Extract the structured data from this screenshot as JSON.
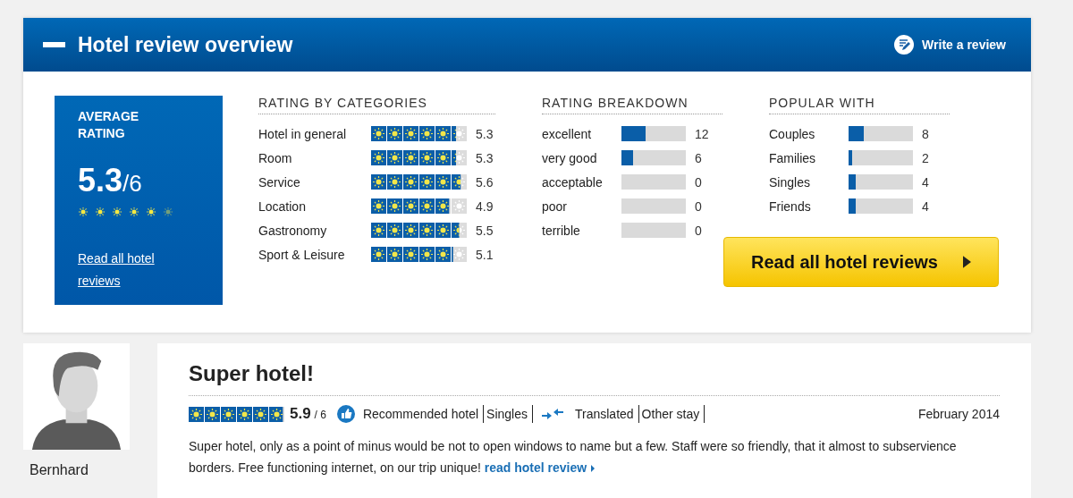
{
  "header": {
    "title": "Hotel review overview",
    "write_review": "Write a review"
  },
  "average": {
    "label": "AVERAGE RATING",
    "score": "5.3",
    "scale": "/6",
    "stars": 5.3,
    "link": "Read all hotel reviews"
  },
  "categories": {
    "title": "RATING BY CATEGORIES",
    "rows": [
      {
        "name": "Hotel in general",
        "stars": 5.3,
        "value": "5.3"
      },
      {
        "name": "Room",
        "stars": 5.3,
        "value": "5.3"
      },
      {
        "name": "Service",
        "stars": 5.6,
        "value": "5.6"
      },
      {
        "name": "Location",
        "stars": 4.9,
        "value": "4.9"
      },
      {
        "name": "Gastronomy",
        "stars": 5.5,
        "value": "5.5"
      },
      {
        "name": "Sport & Leisure",
        "stars": 5.1,
        "value": "5.1"
      }
    ]
  },
  "breakdown": {
    "title": "RATING BREAKDOWN",
    "rows": [
      {
        "name": "excellent",
        "level": 0.37,
        "count": "12"
      },
      {
        "name": "very good",
        "level": 0.18,
        "count": "6"
      },
      {
        "name": "acceptable",
        "count": "0"
      },
      {
        "name": "poor",
        "count": "0"
      },
      {
        "name": "terrible",
        "count": "0"
      }
    ]
  },
  "popular": {
    "title": "POPULAR WITH",
    "rows": [
      {
        "name": "Couples",
        "level": 0.24,
        "count": "8"
      },
      {
        "name": "Families",
        "level": 0.05,
        "count": "2"
      },
      {
        "name": "Singles",
        "level": 0.11,
        "count": "4"
      },
      {
        "name": "Friends",
        "level": 0.11,
        "count": "4"
      }
    ]
  },
  "read_all_button": "Read all hotel reviews",
  "review": {
    "author": "Bernhard",
    "title": "Super hotel!",
    "stars": 5.9,
    "score": "5.9",
    "scale": "/ 6",
    "tags": [
      {
        "kind": "recommended",
        "label": "Recommended hotel"
      },
      {
        "kind": "plain",
        "label": "Singles"
      },
      {
        "kind": "translated",
        "label": "Translated"
      },
      {
        "kind": "plain",
        "label": "Other stay"
      }
    ],
    "date": "February 2014",
    "text": "Super hotel, only as a point of minus would be not to open windows to name but a few. Staff were so friendly, that it almost to subservience borders. Free functioning internet, on our trip unique!",
    "link": "read hotel review"
  }
}
